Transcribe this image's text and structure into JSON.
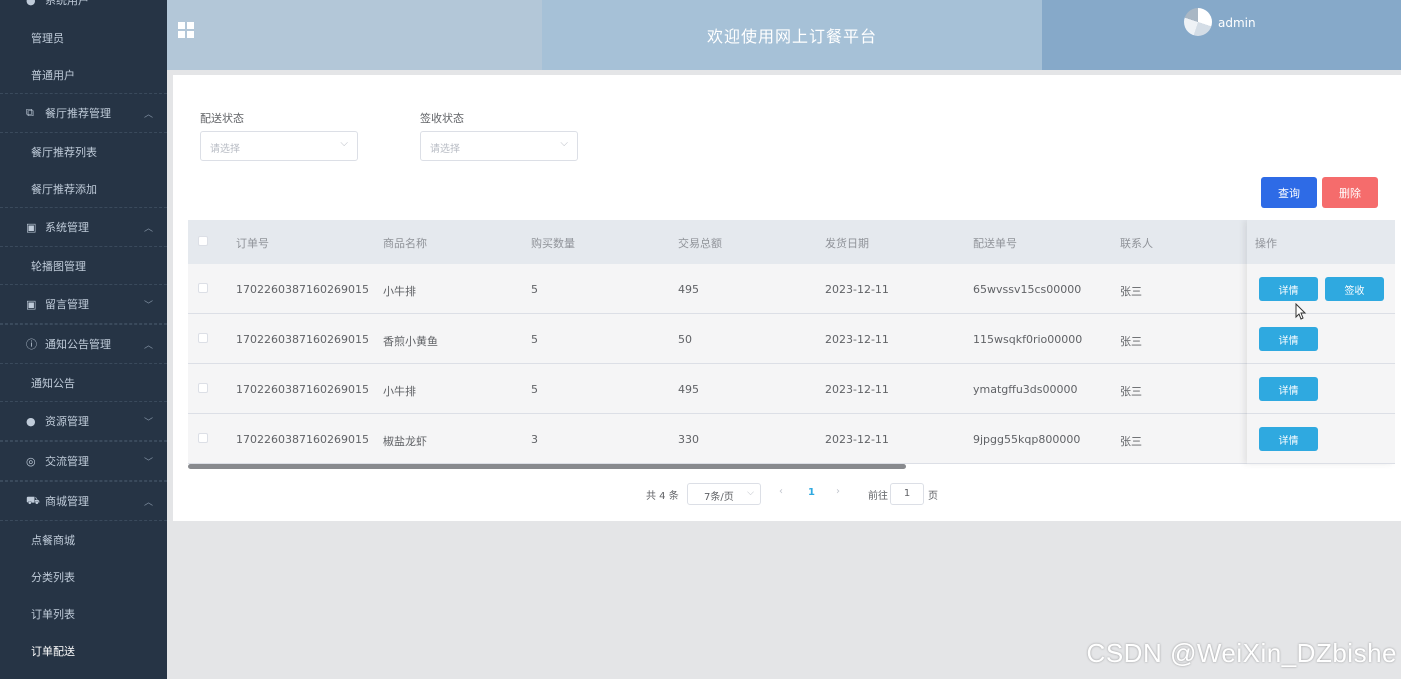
{
  "sidebar": {
    "top_cut": "系统用户",
    "items": [
      {
        "type": "sub",
        "label": "管理员"
      },
      {
        "type": "sub",
        "label": "普通用户"
      },
      {
        "type": "group",
        "icon": "copy-icon",
        "glyph": "⧉",
        "label": "餐厅推荐管理",
        "arrow": "^"
      },
      {
        "type": "sub",
        "label": "餐厅推荐列表"
      },
      {
        "type": "sub",
        "label": "餐厅推荐添加"
      },
      {
        "type": "group",
        "icon": "picture-icon",
        "glyph": "▣",
        "label": "系统管理",
        "arrow": "^"
      },
      {
        "type": "sub",
        "label": "轮播图管理"
      },
      {
        "type": "group",
        "icon": "picture-icon",
        "glyph": "▣",
        "label": "留言管理",
        "arrow": "v"
      },
      {
        "type": "group",
        "icon": "info-icon",
        "glyph": "ⓘ",
        "label": "通知公告管理",
        "arrow": "^"
      },
      {
        "type": "sub",
        "label": "通知公告"
      },
      {
        "type": "group",
        "icon": "location-icon",
        "glyph": "●",
        "label": "资源管理",
        "arrow": "v"
      },
      {
        "type": "group",
        "icon": "chat-icon",
        "glyph": "◎",
        "label": "交流管理",
        "arrow": "v"
      },
      {
        "type": "group",
        "icon": "cart-icon",
        "glyph": "⛟",
        "label": "商城管理",
        "arrow": "^"
      },
      {
        "type": "sub",
        "label": "点餐商城"
      },
      {
        "type": "sub",
        "label": "分类列表"
      },
      {
        "type": "sub",
        "label": "订单列表"
      },
      {
        "type": "sub",
        "label": "订单配送",
        "active": true
      }
    ]
  },
  "header": {
    "title": "欢迎使用网上订餐平台",
    "user": "admin"
  },
  "filters": {
    "delivery_label": "配送状态",
    "delivery_placeholder": "请选择",
    "receipt_label": "签收状态",
    "receipt_placeholder": "请选择"
  },
  "buttons": {
    "query": "查询",
    "delete": "删除"
  },
  "table": {
    "columns": [
      "订单号",
      "商品名称",
      "购买数量",
      "交易总额",
      "发货日期",
      "配送单号",
      "联系人",
      "操作"
    ],
    "rows": [
      {
        "order_no": "1702260387160269015",
        "product": "小牛排",
        "qty": "5",
        "total": "495",
        "date": "2023-12-11",
        "delivery_no": "65wvssv15cs00000",
        "contact": "张三",
        "actions": [
          "详情",
          "签收"
        ]
      },
      {
        "order_no": "1702260387160269015",
        "product": "香煎小黄鱼",
        "qty": "5",
        "total": "50",
        "date": "2023-12-11",
        "delivery_no": "115wsqkf0rio00000",
        "contact": "张三",
        "actions": [
          "详情"
        ]
      },
      {
        "order_no": "1702260387160269015",
        "product": "小牛排",
        "qty": "5",
        "total": "495",
        "date": "2023-12-11",
        "delivery_no": "ymatgffu3ds00000",
        "contact": "张三",
        "actions": [
          "详情"
        ]
      },
      {
        "order_no": "1702260387160269015",
        "product": "椒盐龙虾",
        "qty": "3",
        "total": "330",
        "date": "2023-12-11",
        "delivery_no": "9jpgg55kqp800000",
        "contact": "张三",
        "actions": [
          "详情"
        ]
      }
    ]
  },
  "pagination": {
    "total": "共 4 条",
    "page_size": "7条/页",
    "current_page": "1",
    "goto_prefix": "前往",
    "goto_value": "1",
    "goto_suffix": "页"
  },
  "watermark": "CSDN @WeiXin_DZbishe"
}
